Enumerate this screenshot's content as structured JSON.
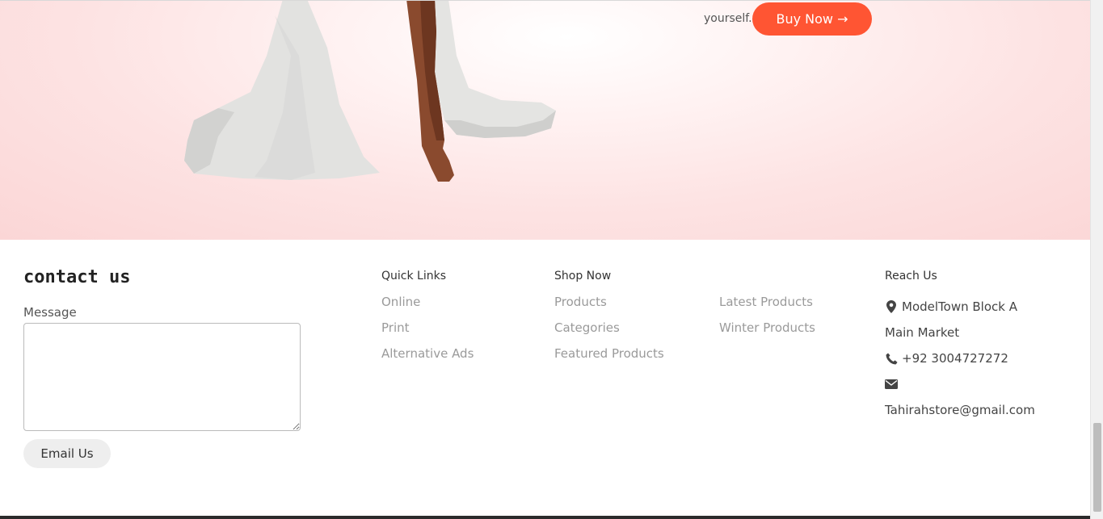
{
  "hero": {
    "text": "yourself.",
    "buy_label": "Buy Now →"
  },
  "contact": {
    "title": "contact us",
    "message_label": "Message",
    "message_value": "",
    "email_button": "Email Us"
  },
  "quick_links": {
    "title": "Quick Links",
    "items": [
      "Online",
      "Print",
      "Alternative Ads"
    ]
  },
  "shop_now": {
    "title": "Shop Now",
    "items": [
      "Products",
      "Categories",
      "Featured Products"
    ],
    "items_col2": [
      "Latest Products",
      "Winter Products"
    ]
  },
  "reach_us": {
    "title": "Reach Us",
    "address_line1": "ModelTown Block A",
    "address_line2": "Main Market",
    "phone": "+92 3004727272",
    "email": "Tahirahstore@gmail.com",
    "icons": [
      "map-marker-icon",
      "phone-icon",
      "envelope-icon"
    ]
  },
  "colors": {
    "accent": "#ff5533",
    "link_gray": "#9a9a9a",
    "hero_pink": "#fbd6d6"
  }
}
